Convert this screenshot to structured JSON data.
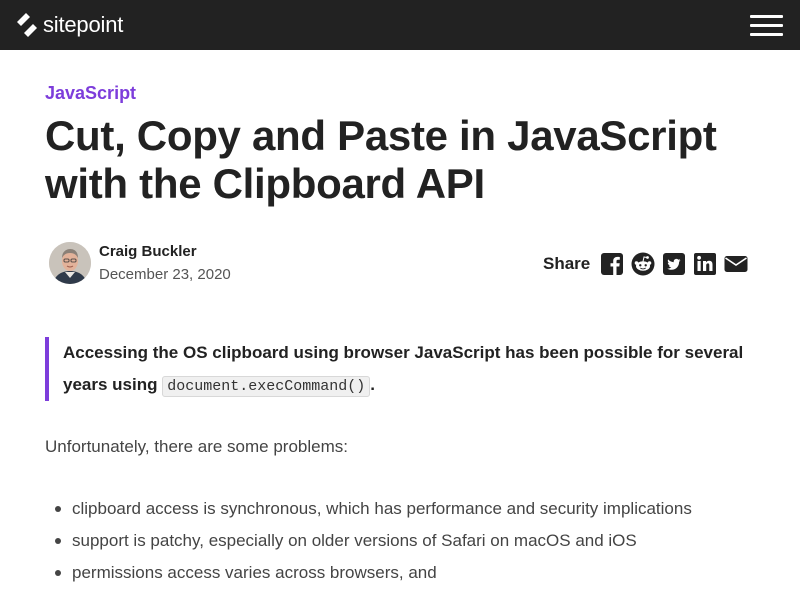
{
  "header": {
    "brand": "sitepoint",
    "logo_icon": "sitepoint-logo-icon",
    "menu_icon": "hamburger-menu-icon",
    "background": "#222222"
  },
  "article": {
    "category": "JavaScript",
    "title": "Cut, Copy and Paste in JavaScript with the Clipboard API",
    "author": {
      "name": "Craig Buckler",
      "date": "December 23, 2020",
      "avatar_icon": "author-avatar"
    },
    "share": {
      "label": "Share",
      "icons": [
        "facebook-icon",
        "reddit-icon",
        "twitter-icon",
        "linkedin-icon",
        "email-icon"
      ]
    },
    "intro": {
      "line1": "Accessing the OS clipboard using browser JavaScript has been possible for several",
      "line2_prefix": "years using ",
      "code": "document.execCommand()",
      "line2_suffix": "."
    },
    "paragraph": "Unfortunately, there are some problems:",
    "bullets": [
      "clipboard access is synchronous, which has performance and security implications",
      "support is patchy, especially on older versions of Safari on macOS and iOS",
      "permissions access varies across browsers, and"
    ]
  },
  "colors": {
    "accent": "#7d3ddb",
    "text": "#222222"
  }
}
